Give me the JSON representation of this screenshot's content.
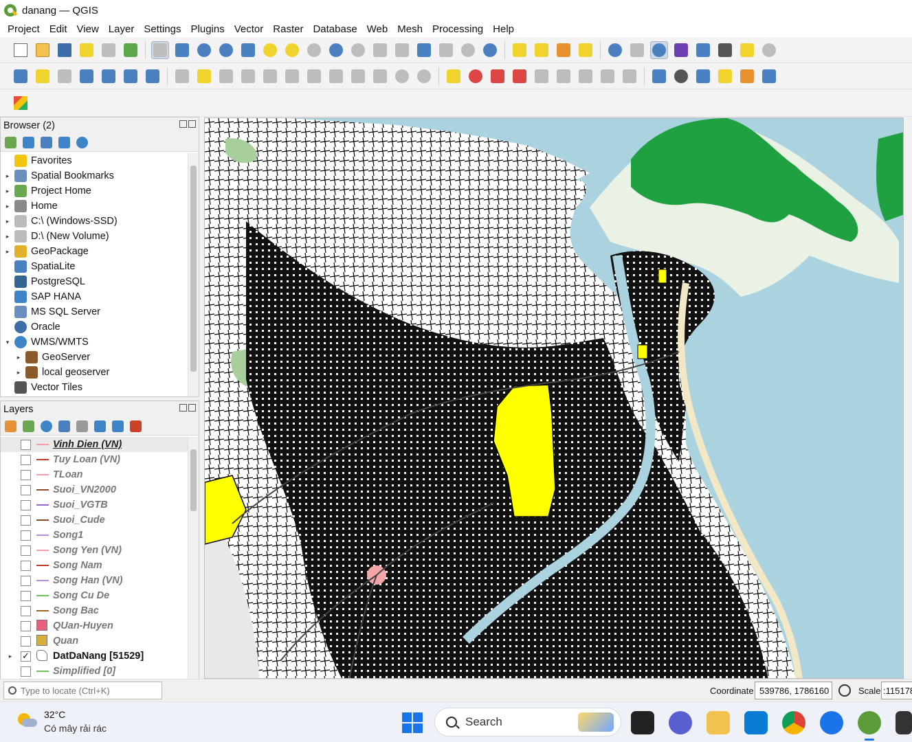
{
  "window": {
    "title": "danang — QGIS"
  },
  "menu": [
    "Project",
    "Edit",
    "View",
    "Layer",
    "Settings",
    "Plugins",
    "Vector",
    "Raster",
    "Database",
    "Web",
    "Mesh",
    "Processing",
    "Help"
  ],
  "browser": {
    "title": "Browser (2)",
    "items": [
      {
        "label": "Favorites",
        "icon": "star-icon",
        "arrow": ""
      },
      {
        "label": "Spatial Bookmarks",
        "icon": "bookmark-icon",
        "arrow": "▸"
      },
      {
        "label": "Project Home",
        "icon": "project-home-icon",
        "arrow": "▸"
      },
      {
        "label": "Home",
        "icon": "home-icon",
        "arrow": "▸"
      },
      {
        "label": "C:\\ (Windows-SSD)",
        "icon": "drive-icon",
        "arrow": "▸"
      },
      {
        "label": "D:\\ (New Volume)",
        "icon": "drive-icon",
        "arrow": "▸"
      },
      {
        "label": "GeoPackage",
        "icon": "geopackage-icon",
        "arrow": "▸"
      },
      {
        "label": "SpatiaLite",
        "icon": "spatialite-icon",
        "arrow": ""
      },
      {
        "label": "PostgreSQL",
        "icon": "postgresql-icon",
        "arrow": ""
      },
      {
        "label": "SAP HANA",
        "icon": "sap-hana-icon",
        "arrow": ""
      },
      {
        "label": "MS SQL Server",
        "icon": "mssql-icon",
        "arrow": ""
      },
      {
        "label": "Oracle",
        "icon": "oracle-icon",
        "arrow": ""
      },
      {
        "label": "WMS/WMTS",
        "icon": "wms-icon",
        "arrow": "▾"
      },
      {
        "label": "GeoServer",
        "icon": "wms-connection-icon",
        "arrow": "▸"
      },
      {
        "label": "local geoserver",
        "icon": "wms-connection-icon",
        "arrow": "▸"
      },
      {
        "label": "Vector Tiles",
        "icon": "vector-tiles-icon",
        "arrow": ""
      }
    ]
  },
  "layers": {
    "title": "Layers",
    "items": [
      {
        "name": "Vinh Dien (VN)",
        "symbol": "line",
        "color": "#f1a0a6",
        "checked": false,
        "state": "selected"
      },
      {
        "name": "Tuy Loan (VN)",
        "symbol": "line",
        "color": "#c0392b",
        "checked": false,
        "state": ""
      },
      {
        "name": "TLoan",
        "symbol": "line",
        "color": "#f1a0a6",
        "checked": false,
        "state": ""
      },
      {
        "name": "Suoi_VN2000",
        "symbol": "line",
        "color": "#8e4b2b",
        "checked": false,
        "state": ""
      },
      {
        "name": "Suoi_VGTB",
        "symbol": "line",
        "color": "#8e6cc8",
        "checked": false,
        "state": ""
      },
      {
        "name": "Suoi_Cude",
        "symbol": "line",
        "color": "#8e4b2b",
        "checked": false,
        "state": ""
      },
      {
        "name": "Song1",
        "symbol": "line",
        "color": "#b38ee0",
        "checked": false,
        "state": ""
      },
      {
        "name": "Song Yen (VN)",
        "symbol": "line",
        "color": "#f1a0a6",
        "checked": false,
        "state": ""
      },
      {
        "name": "Song Nam",
        "symbol": "line",
        "color": "#c0392b",
        "checked": false,
        "state": ""
      },
      {
        "name": "Song Han (VN)",
        "symbol": "line",
        "color": "#b38ee0",
        "checked": false,
        "state": ""
      },
      {
        "name": "Song Cu De",
        "symbol": "line",
        "color": "#6cbf5b",
        "checked": false,
        "state": ""
      },
      {
        "name": "Song Bac",
        "symbol": "line",
        "color": "#a0622d",
        "checked": false,
        "state": ""
      },
      {
        "name": "QUan-Huyen",
        "symbol": "fill",
        "color": "#e8607e",
        "checked": false,
        "state": ""
      },
      {
        "name": "Quan",
        "symbol": "fill",
        "color": "#d4b13c",
        "checked": false,
        "state": ""
      },
      {
        "name": "DatDaNang [51529]",
        "symbol": "polygon",
        "color": "#ffffff",
        "checked": true,
        "state": "active"
      },
      {
        "name": "Simplified [0]",
        "symbol": "line",
        "color": "#6cbf5b",
        "checked": false,
        "state": ""
      }
    ]
  },
  "status": {
    "locator_placeholder": "Type to locate (Ctrl+K)",
    "coordinate_label": "Coordinate",
    "coordinate_value": "539786, 1786160",
    "scale_label": "Scale",
    "scale_value": ":115178"
  },
  "taskbar": {
    "temperature": "32°C",
    "weather": "Có mây rải rác",
    "search_label": "Search",
    "apps": [
      "task-view-icon",
      "copilot-icon",
      "file-explorer-icon",
      "vscode-icon",
      "chrome-icon",
      "zalo-icon",
      "qgis-icon",
      "media-icon"
    ]
  },
  "map": {
    "sea_color": "#aad3df",
    "forest_color": "#1fa142",
    "highlight_color": "#ffff00",
    "parcel_color": "#000000"
  }
}
